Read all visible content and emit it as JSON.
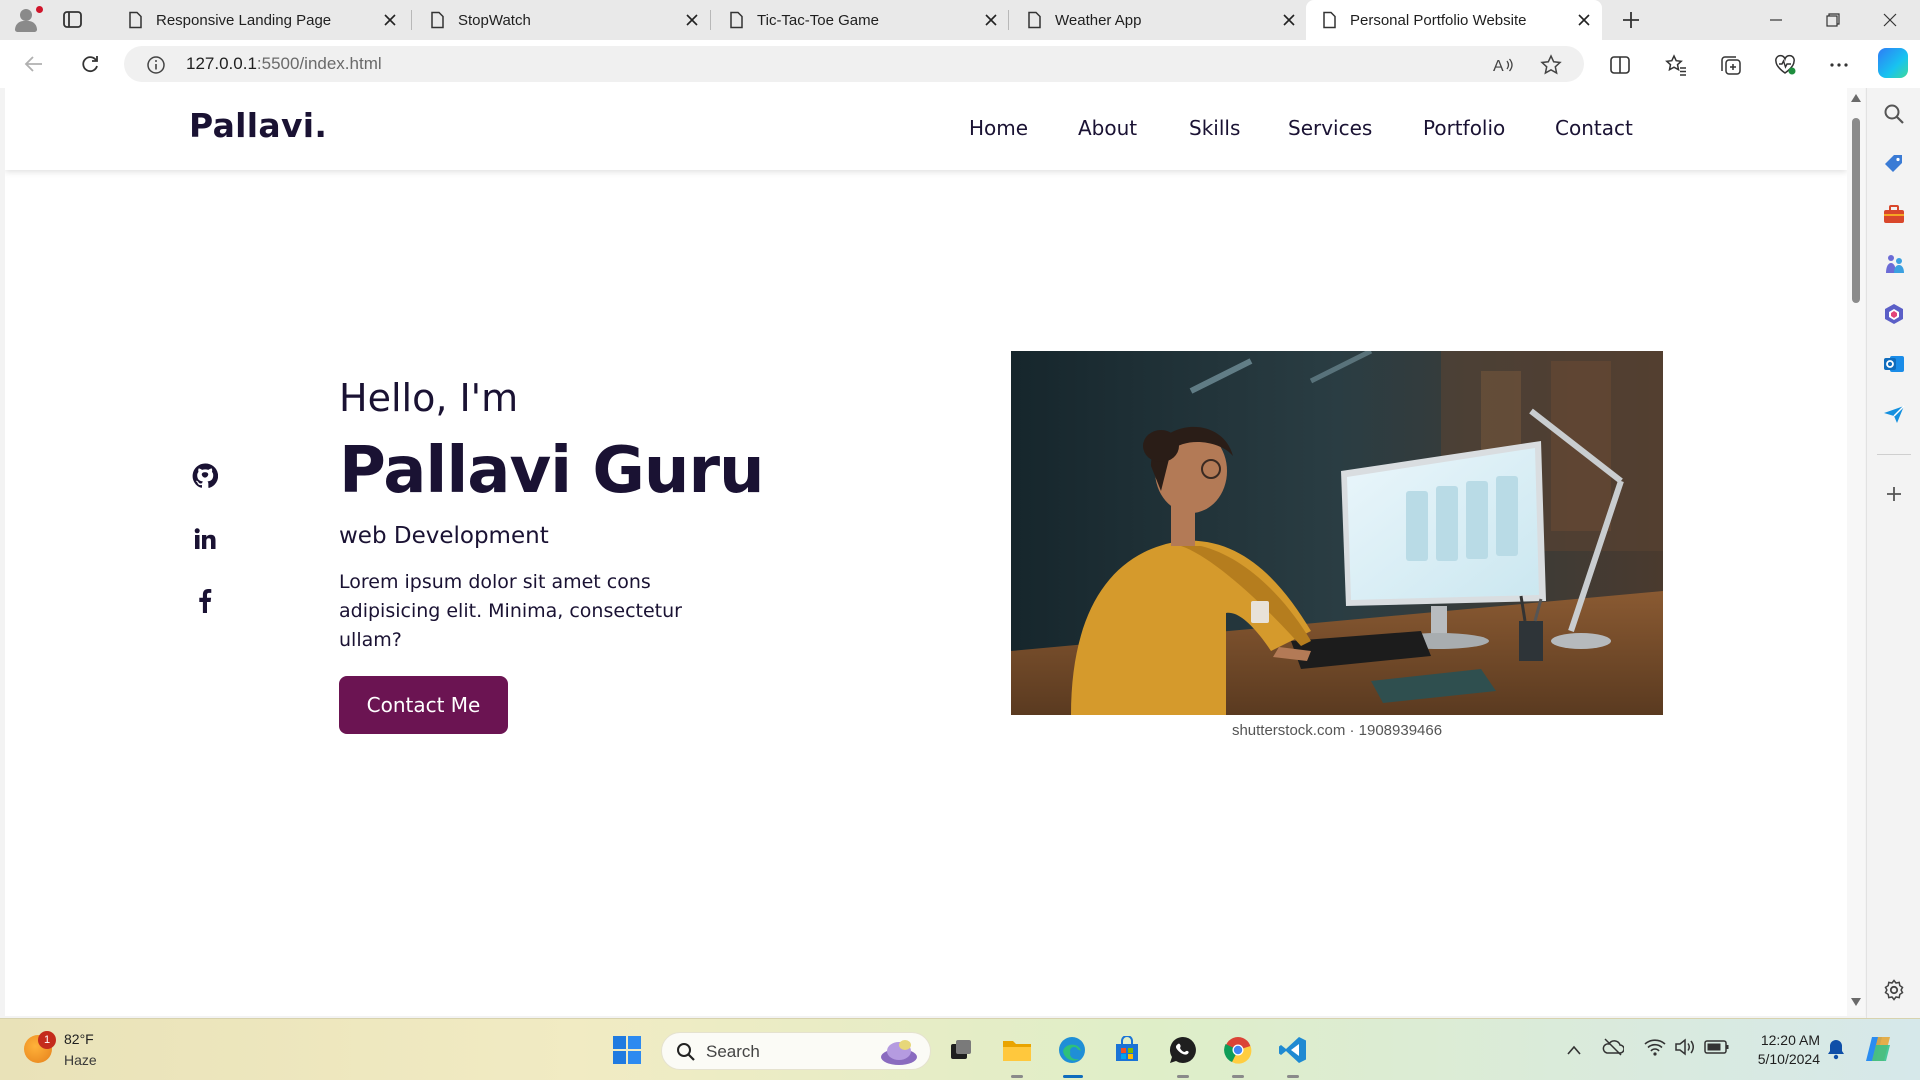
{
  "browser": {
    "tabs": [
      {
        "title": "Responsive Landing Page",
        "active": false
      },
      {
        "title": "StopWatch",
        "active": false
      },
      {
        "title": "Tic-Tac-Toe Game",
        "active": false
      },
      {
        "title": "Weather App",
        "active": false
      },
      {
        "title": "Personal Portfolio Website",
        "active": true
      }
    ],
    "url_host": "127.0.0.1",
    "url_path": ":5500/index.html"
  },
  "site": {
    "logo": "Pallavi.",
    "nav": [
      "Home",
      "About",
      "Skills",
      "Services",
      "Portfolio",
      "Contact"
    ],
    "social": [
      "github-icon",
      "linkedin-icon",
      "facebook-icon"
    ],
    "hero": {
      "greeting": "Hello, I'm",
      "name": "Pallavi Guru",
      "role": "web Development",
      "description": "Lorem ipsum dolor sit amet cons adipisicing elit. Minima, consectetur ullam?",
      "cta": "Contact Me",
      "image_caption": "shutterstock.com · 1908939466"
    },
    "accent_color": "#6b1452",
    "text_color": "#1a1233"
  },
  "taskbar": {
    "weather_temp": "82°F",
    "weather_condition": "Haze",
    "weather_badge": "1",
    "search_placeholder": "Search",
    "time": "12:20 AM",
    "date": "5/10/2024"
  }
}
